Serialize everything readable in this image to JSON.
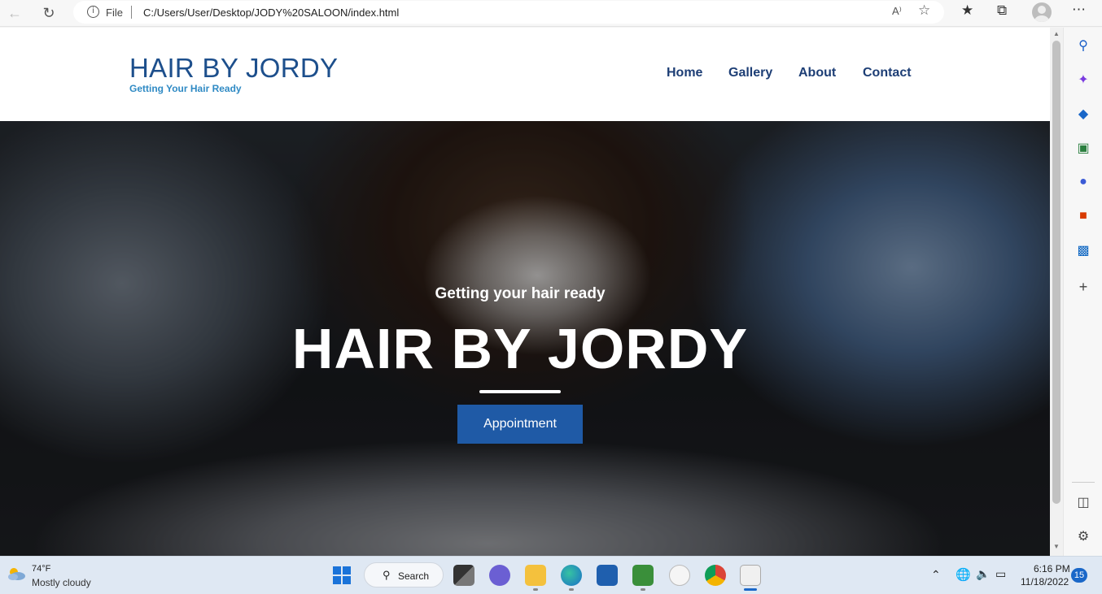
{
  "browser": {
    "file_label": "File",
    "url": "C:/Users/User/Desktop/JODY%20SALOON/index.html",
    "read_aloud": "A⁾",
    "icons": [
      "back-icon",
      "refresh-icon",
      "info-icon",
      "read-aloud-icon",
      "add-favorite-icon",
      "favorites-icon",
      "collections-icon",
      "profile-icon",
      "more-icon"
    ]
  },
  "site": {
    "brand_title": "HAIR BY JORDY",
    "brand_tagline": "Getting Your Hair Ready",
    "nav": [
      {
        "label": "Home"
      },
      {
        "label": "Gallery"
      },
      {
        "label": "About"
      },
      {
        "label": "Contact"
      }
    ]
  },
  "hero": {
    "subtitle": "Getting your hair ready",
    "title": "HAIR BY JORDY",
    "button_label": "Appointment"
  },
  "sidebar": {
    "icons": [
      "search-icon",
      "copilot-icon",
      "shopping-icon",
      "tools-icon",
      "games-icon",
      "office-icon",
      "outlook-icon",
      "add-icon",
      "split-screen-icon",
      "settings-icon"
    ]
  },
  "taskbar": {
    "weather_temp": "74°F",
    "weather_desc": "Mostly cloudy",
    "search_label": "Search",
    "time": "6:16 PM",
    "date": "11/18/2022",
    "notifications": "15"
  },
  "colors": {
    "brand": "#1d4f8c",
    "tagline": "#2f8ac4",
    "nav": "#1d3e75",
    "button": "#1f5aa6"
  }
}
